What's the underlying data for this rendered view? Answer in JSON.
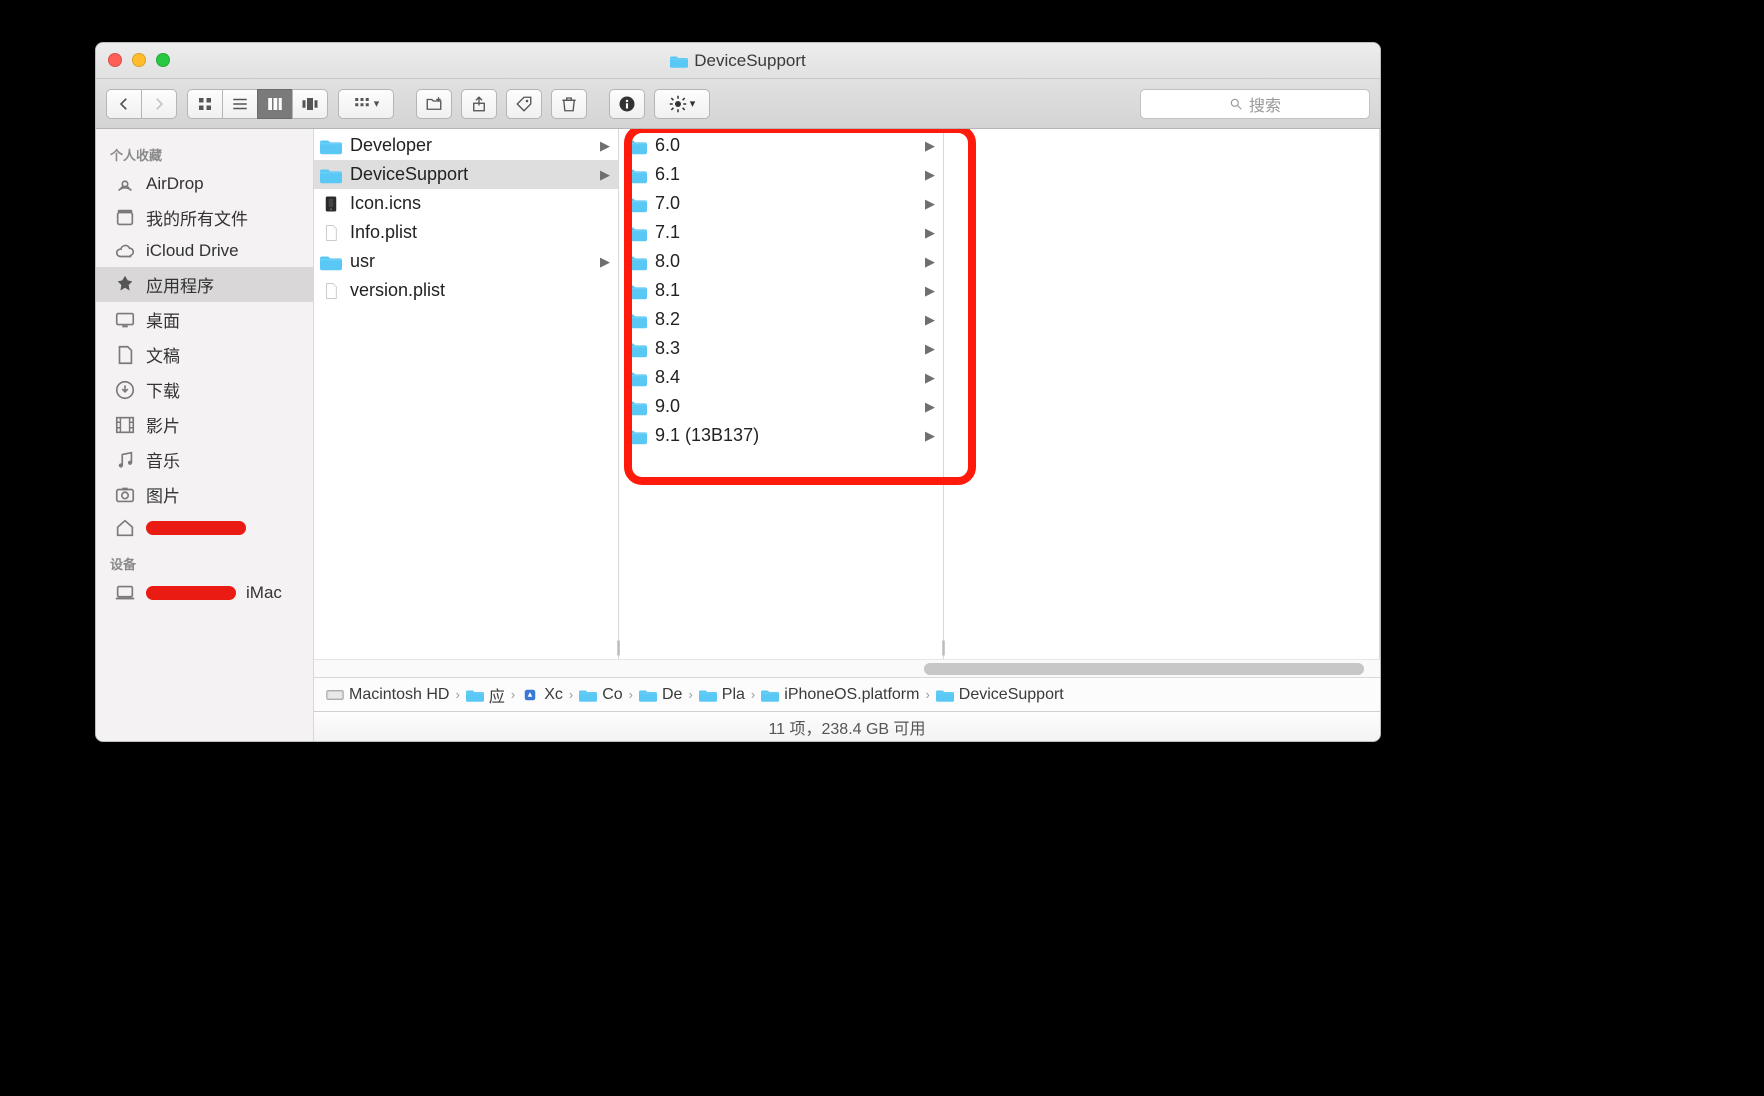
{
  "window": {
    "title": "DeviceSupport"
  },
  "toolbar": {
    "search_placeholder": "搜索"
  },
  "sidebar": {
    "heading_fav": "个人收藏",
    "heading_dev": "设备",
    "airdrop": "AirDrop",
    "allfiles": "我的所有文件",
    "icloud": "iCloud Drive",
    "apps": "应用程序",
    "desktop": "桌面",
    "docs": "文稿",
    "downloads": "下载",
    "movies": "影片",
    "music": "音乐",
    "pictures": "图片",
    "home_suffix": "",
    "dev_suffix": "iMac"
  },
  "col1": [
    {
      "icon": "folder",
      "label": "Developer",
      "arrow": true,
      "selected": false
    },
    {
      "icon": "folder",
      "label": "DeviceSupport",
      "arrow": true,
      "selected": true
    },
    {
      "icon": "icns",
      "label": "Icon.icns",
      "arrow": false,
      "selected": false
    },
    {
      "icon": "plist",
      "label": "Info.plist",
      "arrow": false,
      "selected": false
    },
    {
      "icon": "folder",
      "label": "usr",
      "arrow": true,
      "selected": false
    },
    {
      "icon": "plist",
      "label": "version.plist",
      "arrow": false,
      "selected": false
    }
  ],
  "col2": [
    {
      "label": "6.0"
    },
    {
      "label": "6.1"
    },
    {
      "label": "7.0"
    },
    {
      "label": "7.1"
    },
    {
      "label": "8.0"
    },
    {
      "label": "8.1"
    },
    {
      "label": "8.2"
    },
    {
      "label": "8.3"
    },
    {
      "label": "8.4"
    },
    {
      "label": "9.0"
    },
    {
      "label": "9.1 (13B137)"
    }
  ],
  "path": [
    {
      "icon": "hd",
      "label": "Macintosh HD"
    },
    {
      "icon": "folder",
      "label": "应"
    },
    {
      "icon": "app",
      "label": "Xc"
    },
    {
      "icon": "folder",
      "label": "Co"
    },
    {
      "icon": "folder",
      "label": "De"
    },
    {
      "icon": "folder",
      "label": "Pla"
    },
    {
      "icon": "folder",
      "label": "iPhoneOS.platform"
    },
    {
      "icon": "folder",
      "label": "DeviceSupport"
    }
  ],
  "status": "11 项，238.4 GB 可用",
  "colors": {
    "folder": "#5ac8f5",
    "annotation": "#ff1a0c"
  }
}
